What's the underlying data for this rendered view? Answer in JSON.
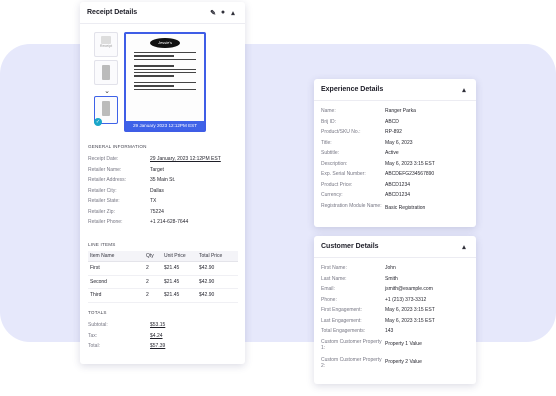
{
  "receipt": {
    "title": "Receipt Details",
    "thumbnail_label": "Receipt",
    "preview_date": "29 January 2023 12:12PM EST",
    "logo_text": "Jessie's",
    "general_heading": "GENERAL INFORMATION",
    "general": [
      {
        "label": "Receipt Date:",
        "value": "29 January, 2023 12:12PM EST"
      },
      {
        "label": "Retailer Name:",
        "value": "Target"
      },
      {
        "label": "Retailer Address:",
        "value": "35 Main St."
      },
      {
        "label": "Retailer City:",
        "value": "Dallas"
      },
      {
        "label": "Retailer State:",
        "value": "TX"
      },
      {
        "label": "Retailer Zip:",
        "value": "75224"
      },
      {
        "label": "Retailer Phone:",
        "value": "+1 214-628-7644"
      }
    ],
    "line_items_heading": "LINE ITEMS",
    "line_item_columns": [
      "Item Name",
      "Qty",
      "Unit Price",
      "Total Price"
    ],
    "line_items": [
      {
        "name": "First",
        "qty": "2",
        "unit": "$21.45",
        "total": "$42.90"
      },
      {
        "name": "Second",
        "qty": "2",
        "unit": "$21.45",
        "total": "$42.90"
      },
      {
        "name": "Third",
        "qty": "2",
        "unit": "$21.45",
        "total": "$42.90"
      }
    ],
    "totals_heading": "TOTALS",
    "totals": [
      {
        "label": "Subtotal:",
        "value": "$53.15"
      },
      {
        "label": "Tax:",
        "value": "$4.24"
      },
      {
        "label": "Total:",
        "value": "$57.39"
      }
    ]
  },
  "experience": {
    "title": "Experience Details",
    "fields": [
      {
        "label": "Name:",
        "value": "Ranger Parka"
      },
      {
        "label": "Brij ID:",
        "value": "ABCD"
      },
      {
        "label": "Product/SKU No.:",
        "value": "RP-892"
      },
      {
        "label": "Title:",
        "value": "May 6, 2023"
      },
      {
        "label": "Subtitle:",
        "value": "Active"
      },
      {
        "label": "Description:",
        "value": "May 6, 2023 3:15 EST"
      },
      {
        "label": "Exp. Serial Number:",
        "value": "ABCDEFG234567890"
      },
      {
        "label": "Product Price:",
        "value": "ABCD1234"
      },
      {
        "label": "Currency:",
        "value": "ABCD1234"
      },
      {
        "label": "Registration Module Name:",
        "value": "Basic Registration"
      }
    ]
  },
  "customer": {
    "title": "Customer Details",
    "fields": [
      {
        "label": "First Name:",
        "value": "John"
      },
      {
        "label": "Last Name:",
        "value": "Smith"
      },
      {
        "label": "Email:",
        "value": "jsmith@example.com"
      },
      {
        "label": "Phone:",
        "value": "+1 (213) 373-3312"
      },
      {
        "label": "First Engagement:",
        "value": "May 6, 2023 3:15 EST"
      },
      {
        "label": "Last Engagement:",
        "value": "May 6, 2023 3:15 EST"
      },
      {
        "label": "Total Engagements:",
        "value": "143"
      },
      {
        "label": "Custom Customer Property 1:",
        "value": "Property 1 Value"
      },
      {
        "label": "Custom Customer Property 2:",
        "value": "Property 2 Value"
      }
    ]
  },
  "colors": {
    "accent": "#3e62e8",
    "band": "#e6e8fb",
    "check": "#1aa7c9"
  },
  "icons": [
    "edit-icon",
    "eye-icon",
    "caret-up-icon",
    "chevron-down-icon",
    "check-icon"
  ]
}
